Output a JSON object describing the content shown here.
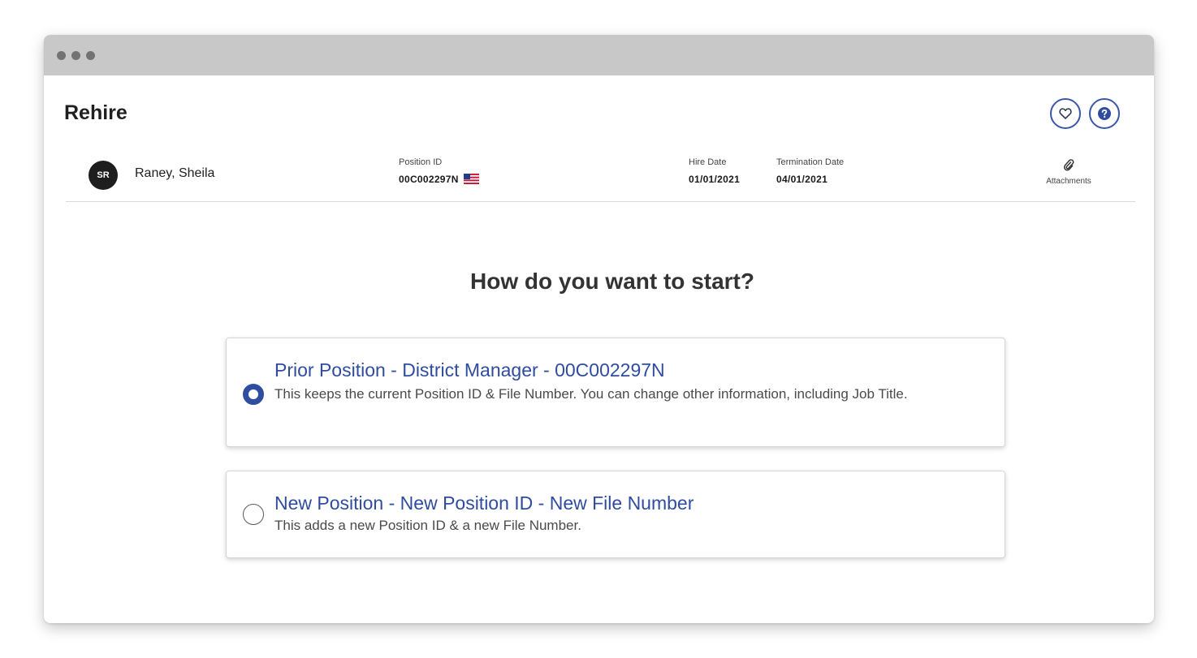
{
  "page": {
    "title": "Rehire"
  },
  "header_icons": {
    "favorite": "heart-icon",
    "help": "question-icon"
  },
  "employee": {
    "initials": "SR",
    "name": "Raney, Sheila",
    "position_id_label": "Position ID",
    "position_id": "00C002297N",
    "country_flag": "us-flag-icon",
    "hire_date_label": "Hire Date",
    "hire_date": "01/01/2021",
    "termination_date_label": "Termination Date",
    "termination_date": "04/01/2021",
    "attachments_label": "Attachments"
  },
  "main": {
    "question": "How do you want to start?",
    "options": [
      {
        "title": "Prior Position - District Manager - 00C002297N",
        "description": "This keeps the current Position ID & File Number. You can change other information, including Job Title.",
        "selected": true
      },
      {
        "title": "New Position - New Position ID - New File Number",
        "description": "This adds a new Position ID & a new File Number.",
        "selected": false
      }
    ]
  },
  "colors": {
    "accent": "#2f4c9f",
    "titlebar": "#c8c8c8",
    "avatar_bg": "#1e1e1e"
  }
}
